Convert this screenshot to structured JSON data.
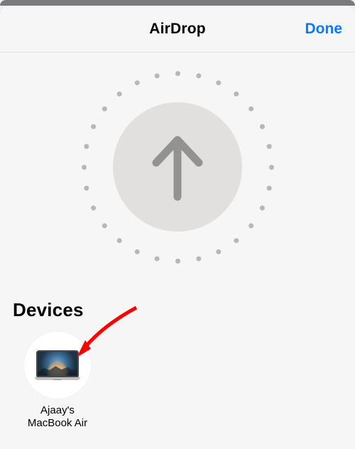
{
  "header": {
    "title": "AirDrop",
    "done_label": "Done"
  },
  "devices": {
    "section_label": "Devices",
    "items": [
      {
        "name": "Ajaay's\nMacBook Air"
      }
    ]
  }
}
